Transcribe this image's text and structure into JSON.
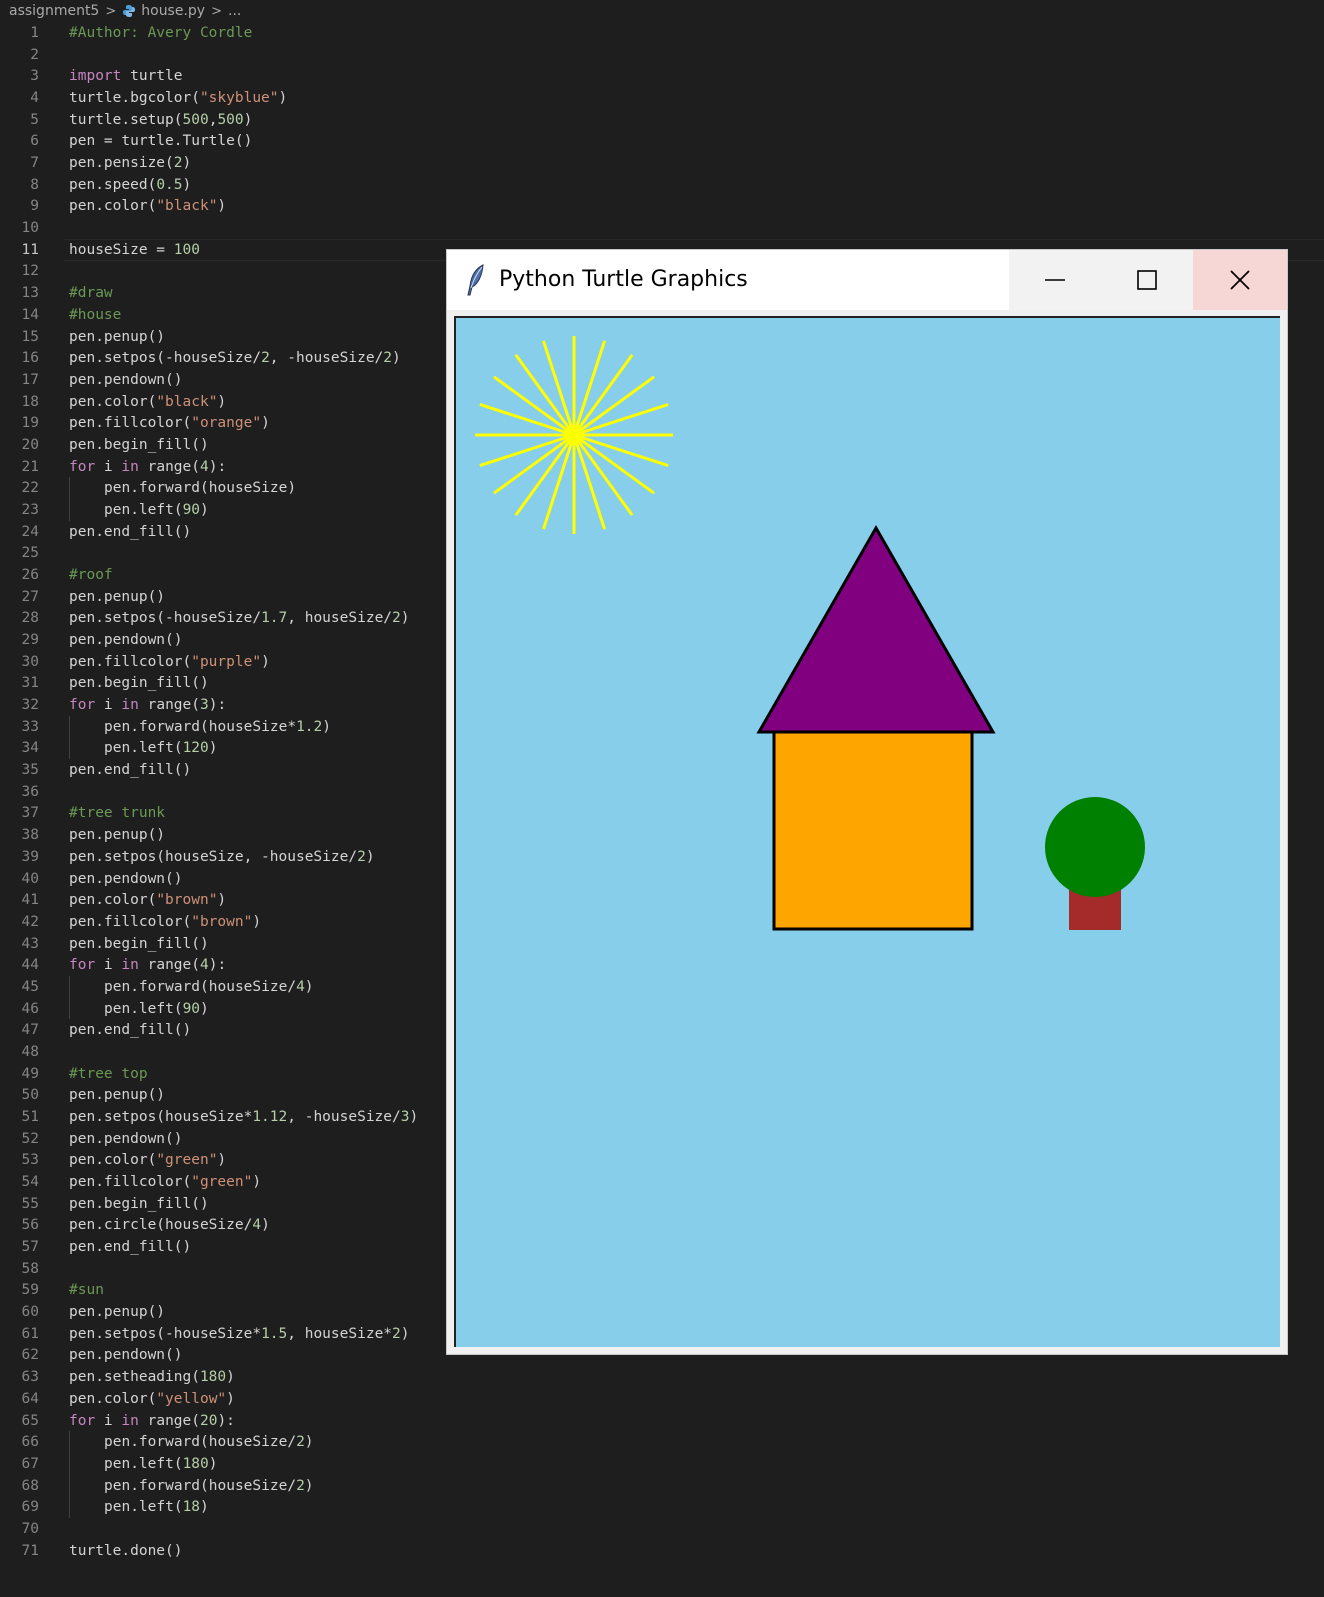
{
  "breadcrumb": {
    "folder": "assignment5",
    "file": "house.py",
    "more": "..."
  },
  "active_line": 11,
  "lines": [
    {
      "n": "1",
      "tokens": [
        [
          "cm",
          "#Author: Avery Cordle"
        ]
      ]
    },
    {
      "n": "2",
      "tokens": []
    },
    {
      "n": "3",
      "tokens": [
        [
          "kw",
          "import"
        ],
        [
          "id",
          " turtle"
        ]
      ]
    },
    {
      "n": "4",
      "tokens": [
        [
          "id",
          "turtle.bgcolor("
        ],
        [
          "st",
          "\"skyblue\""
        ],
        [
          "id",
          ")"
        ]
      ]
    },
    {
      "n": "5",
      "tokens": [
        [
          "id",
          "turtle.setup("
        ],
        [
          "nu",
          "500"
        ],
        [
          "id",
          ","
        ],
        [
          "nu",
          "500"
        ],
        [
          "id",
          ")"
        ]
      ]
    },
    {
      "n": "6",
      "tokens": [
        [
          "id",
          "pen = turtle.Turtle()"
        ]
      ]
    },
    {
      "n": "7",
      "tokens": [
        [
          "id",
          "pen.pensize("
        ],
        [
          "nu",
          "2"
        ],
        [
          "id",
          ")"
        ]
      ]
    },
    {
      "n": "8",
      "tokens": [
        [
          "id",
          "pen.speed("
        ],
        [
          "nu",
          "0.5"
        ],
        [
          "id",
          ")"
        ]
      ]
    },
    {
      "n": "9",
      "tokens": [
        [
          "id",
          "pen.color("
        ],
        [
          "st",
          "\"black\""
        ],
        [
          "id",
          ")"
        ]
      ]
    },
    {
      "n": "10",
      "tokens": []
    },
    {
      "n": "11",
      "tokens": [
        [
          "id",
          "houseSize = "
        ],
        [
          "nu",
          "100"
        ]
      ]
    },
    {
      "n": "12",
      "tokens": []
    },
    {
      "n": "13",
      "tokens": [
        [
          "cm",
          "#draw"
        ]
      ]
    },
    {
      "n": "14",
      "tokens": [
        [
          "cm",
          "#house"
        ]
      ]
    },
    {
      "n": "15",
      "tokens": [
        [
          "id",
          "pen.penup()"
        ]
      ]
    },
    {
      "n": "16",
      "tokens": [
        [
          "id",
          "pen.setpos(-houseSize/"
        ],
        [
          "nu",
          "2"
        ],
        [
          "id",
          ", -houseSize/"
        ],
        [
          "nu",
          "2"
        ],
        [
          "id",
          ")"
        ]
      ]
    },
    {
      "n": "17",
      "tokens": [
        [
          "id",
          "pen.pendown()"
        ]
      ]
    },
    {
      "n": "18",
      "tokens": [
        [
          "id",
          "pen.color("
        ],
        [
          "st",
          "\"black\""
        ],
        [
          "id",
          ")"
        ]
      ]
    },
    {
      "n": "19",
      "tokens": [
        [
          "id",
          "pen.fillcolor("
        ],
        [
          "st",
          "\"orange\""
        ],
        [
          "id",
          ")"
        ]
      ]
    },
    {
      "n": "20",
      "tokens": [
        [
          "id",
          "pen.begin_fill()"
        ]
      ]
    },
    {
      "n": "21",
      "tokens": [
        [
          "kw",
          "for"
        ],
        [
          "id",
          " i "
        ],
        [
          "kw",
          "in"
        ],
        [
          "id",
          " range("
        ],
        [
          "nu",
          "4"
        ],
        [
          "id",
          "):"
        ]
      ]
    },
    {
      "n": "22",
      "indent": 1,
      "tokens": [
        [
          "id",
          "pen.forward(houseSize)"
        ]
      ]
    },
    {
      "n": "23",
      "indent": 1,
      "tokens": [
        [
          "id",
          "pen.left("
        ],
        [
          "nu",
          "90"
        ],
        [
          "id",
          ")"
        ]
      ]
    },
    {
      "n": "24",
      "tokens": [
        [
          "id",
          "pen.end_fill()"
        ]
      ]
    },
    {
      "n": "25",
      "tokens": []
    },
    {
      "n": "26",
      "tokens": [
        [
          "cm",
          "#roof"
        ]
      ]
    },
    {
      "n": "27",
      "tokens": [
        [
          "id",
          "pen.penup()"
        ]
      ]
    },
    {
      "n": "28",
      "tokens": [
        [
          "id",
          "pen.setpos(-houseSize/"
        ],
        [
          "nu",
          "1.7"
        ],
        [
          "id",
          ", houseSize/"
        ],
        [
          "nu",
          "2"
        ],
        [
          "id",
          ")"
        ]
      ]
    },
    {
      "n": "29",
      "tokens": [
        [
          "id",
          "pen.pendown()"
        ]
      ]
    },
    {
      "n": "30",
      "tokens": [
        [
          "id",
          "pen.fillcolor("
        ],
        [
          "st",
          "\"purple\""
        ],
        [
          "id",
          ")"
        ]
      ]
    },
    {
      "n": "31",
      "tokens": [
        [
          "id",
          "pen.begin_fill()"
        ]
      ]
    },
    {
      "n": "32",
      "tokens": [
        [
          "kw",
          "for"
        ],
        [
          "id",
          " i "
        ],
        [
          "kw",
          "in"
        ],
        [
          "id",
          " range("
        ],
        [
          "nu",
          "3"
        ],
        [
          "id",
          "):"
        ]
      ]
    },
    {
      "n": "33",
      "indent": 1,
      "tokens": [
        [
          "id",
          "pen.forward(houseSize*"
        ],
        [
          "nu",
          "1.2"
        ],
        [
          "id",
          ")"
        ]
      ]
    },
    {
      "n": "34",
      "indent": 1,
      "tokens": [
        [
          "id",
          "pen.left("
        ],
        [
          "nu",
          "120"
        ],
        [
          "id",
          ")"
        ]
      ]
    },
    {
      "n": "35",
      "tokens": [
        [
          "id",
          "pen.end_fill()"
        ]
      ]
    },
    {
      "n": "36",
      "tokens": []
    },
    {
      "n": "37",
      "tokens": [
        [
          "cm",
          "#tree trunk"
        ]
      ]
    },
    {
      "n": "38",
      "tokens": [
        [
          "id",
          "pen.penup()"
        ]
      ]
    },
    {
      "n": "39",
      "tokens": [
        [
          "id",
          "pen.setpos(houseSize, -houseSize/"
        ],
        [
          "nu",
          "2"
        ],
        [
          "id",
          ")"
        ]
      ]
    },
    {
      "n": "40",
      "tokens": [
        [
          "id",
          "pen.pendown()"
        ]
      ]
    },
    {
      "n": "41",
      "tokens": [
        [
          "id",
          "pen.color("
        ],
        [
          "st",
          "\"brown\""
        ],
        [
          "id",
          ")"
        ]
      ]
    },
    {
      "n": "42",
      "tokens": [
        [
          "id",
          "pen.fillcolor("
        ],
        [
          "st",
          "\"brown\""
        ],
        [
          "id",
          ")"
        ]
      ]
    },
    {
      "n": "43",
      "tokens": [
        [
          "id",
          "pen.begin_fill()"
        ]
      ]
    },
    {
      "n": "44",
      "tokens": [
        [
          "kw",
          "for"
        ],
        [
          "id",
          " i "
        ],
        [
          "kw",
          "in"
        ],
        [
          "id",
          " range("
        ],
        [
          "nu",
          "4"
        ],
        [
          "id",
          "):"
        ]
      ]
    },
    {
      "n": "45",
      "indent": 1,
      "tokens": [
        [
          "id",
          "pen.forward(houseSize/"
        ],
        [
          "nu",
          "4"
        ],
        [
          "id",
          ")"
        ]
      ]
    },
    {
      "n": "46",
      "indent": 1,
      "tokens": [
        [
          "id",
          "pen.left("
        ],
        [
          "nu",
          "90"
        ],
        [
          "id",
          ")"
        ]
      ]
    },
    {
      "n": "47",
      "tokens": [
        [
          "id",
          "pen.end_fill()"
        ]
      ]
    },
    {
      "n": "48",
      "tokens": []
    },
    {
      "n": "49",
      "tokens": [
        [
          "cm",
          "#tree top"
        ]
      ]
    },
    {
      "n": "50",
      "tokens": [
        [
          "id",
          "pen.penup()"
        ]
      ]
    },
    {
      "n": "51",
      "tokens": [
        [
          "id",
          "pen.setpos(houseSize*"
        ],
        [
          "nu",
          "1.12"
        ],
        [
          "id",
          ", -houseSize/"
        ],
        [
          "nu",
          "3"
        ],
        [
          "id",
          ")"
        ]
      ]
    },
    {
      "n": "52",
      "tokens": [
        [
          "id",
          "pen.pendown()"
        ]
      ]
    },
    {
      "n": "53",
      "tokens": [
        [
          "id",
          "pen.color("
        ],
        [
          "st",
          "\"green\""
        ],
        [
          "id",
          ")"
        ]
      ]
    },
    {
      "n": "54",
      "tokens": [
        [
          "id",
          "pen.fillcolor("
        ],
        [
          "st",
          "\"green\""
        ],
        [
          "id",
          ")"
        ]
      ]
    },
    {
      "n": "55",
      "tokens": [
        [
          "id",
          "pen.begin_fill()"
        ]
      ]
    },
    {
      "n": "56",
      "tokens": [
        [
          "id",
          "pen.circle(houseSize/"
        ],
        [
          "nu",
          "4"
        ],
        [
          "id",
          ")"
        ]
      ]
    },
    {
      "n": "57",
      "tokens": [
        [
          "id",
          "pen.end_fill()"
        ]
      ]
    },
    {
      "n": "58",
      "tokens": []
    },
    {
      "n": "59",
      "tokens": [
        [
          "cm",
          "#sun"
        ]
      ]
    },
    {
      "n": "60",
      "tokens": [
        [
          "id",
          "pen.penup()"
        ]
      ]
    },
    {
      "n": "61",
      "tokens": [
        [
          "id",
          "pen.setpos(-houseSize*"
        ],
        [
          "nu",
          "1.5"
        ],
        [
          "id",
          ", houseSize*"
        ],
        [
          "nu",
          "2"
        ],
        [
          "id",
          ")"
        ]
      ]
    },
    {
      "n": "62",
      "tokens": [
        [
          "id",
          "pen.pendown()"
        ]
      ]
    },
    {
      "n": "63",
      "tokens": [
        [
          "id",
          "pen.setheading("
        ],
        [
          "nu",
          "180"
        ],
        [
          "id",
          ")"
        ]
      ]
    },
    {
      "n": "64",
      "tokens": [
        [
          "id",
          "pen.color("
        ],
        [
          "st",
          "\"yellow\""
        ],
        [
          "id",
          ")"
        ]
      ]
    },
    {
      "n": "65",
      "tokens": [
        [
          "kw",
          "for"
        ],
        [
          "id",
          " i "
        ],
        [
          "kw",
          "in"
        ],
        [
          "id",
          " range("
        ],
        [
          "nu",
          "20"
        ],
        [
          "id",
          "):"
        ]
      ]
    },
    {
      "n": "66",
      "indent": 1,
      "tokens": [
        [
          "id",
          "pen.forward(houseSize/"
        ],
        [
          "nu",
          "2"
        ],
        [
          "id",
          ")"
        ]
      ]
    },
    {
      "n": "67",
      "indent": 1,
      "tokens": [
        [
          "id",
          "pen.left("
        ],
        [
          "nu",
          "180"
        ],
        [
          "id",
          ")"
        ]
      ]
    },
    {
      "n": "68",
      "indent": 1,
      "tokens": [
        [
          "id",
          "pen.forward(houseSize/"
        ],
        [
          "nu",
          "2"
        ],
        [
          "id",
          ")"
        ]
      ]
    },
    {
      "n": "69",
      "indent": 1,
      "tokens": [
        [
          "id",
          "pen.left("
        ],
        [
          "nu",
          "18"
        ],
        [
          "id",
          ")"
        ]
      ]
    },
    {
      "n": "70",
      "tokens": []
    },
    {
      "n": "71",
      "tokens": [
        [
          "id",
          "turtle.done()"
        ]
      ]
    }
  ],
  "turtle_window": {
    "title": "Python Turtle Graphics",
    "icon": "feather-icon",
    "buttons": [
      "minimize-icon",
      "maximize-icon",
      "close-icon"
    ]
  },
  "colors": {
    "editor_bg": "#1e1e1e",
    "sky": "#87ceeb",
    "house": "#ffa500",
    "roof": "#800080",
    "trunk": "#a52a2a",
    "tree": "#008000",
    "sun": "#ffff00",
    "outline": "#000000"
  }
}
